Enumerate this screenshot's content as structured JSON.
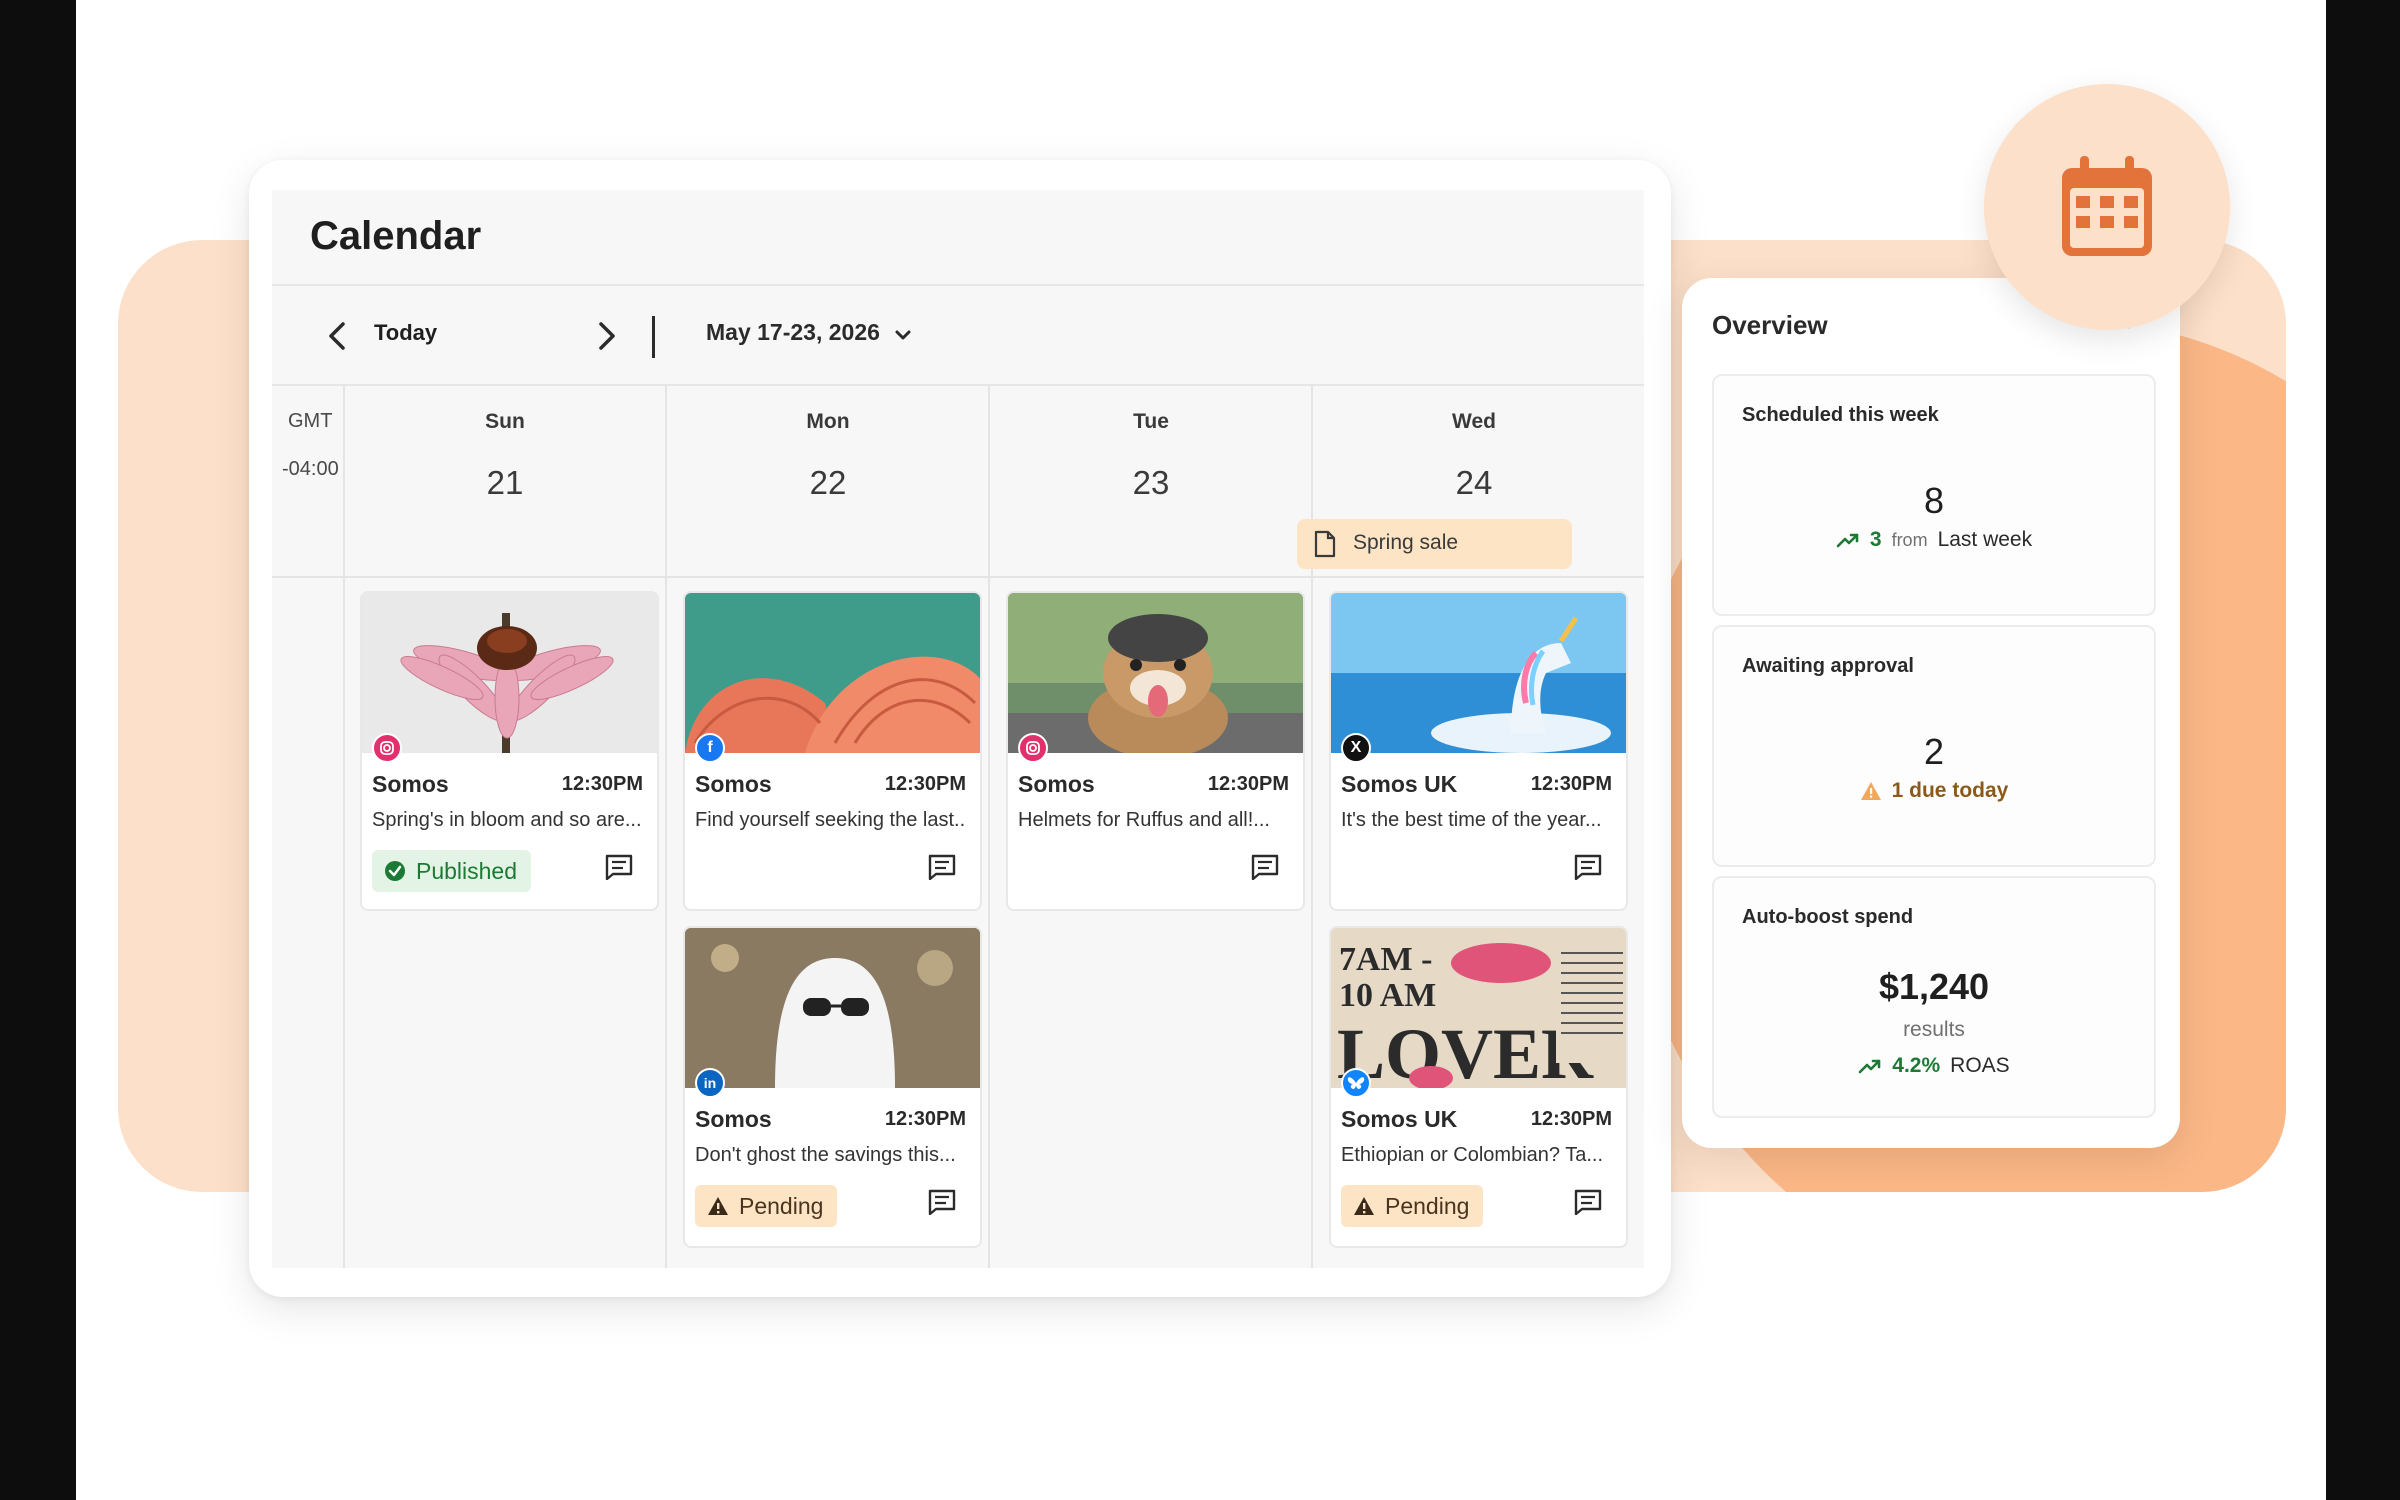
{
  "calendar": {
    "title": "Calendar",
    "toolbar": {
      "today_label": "Today",
      "range_label": "May 17-23, 2026"
    },
    "timezone": {
      "label": "GMT",
      "offset": "-04:00"
    },
    "days": [
      {
        "name": "Sun",
        "number": "21"
      },
      {
        "name": "Mon",
        "number": "22"
      },
      {
        "name": "Tue",
        "number": "23"
      },
      {
        "name": "Wed",
        "number": "24"
      }
    ],
    "event": {
      "label": "Spring sale"
    },
    "posts": [
      {
        "account": "Somos",
        "time": "12:30PM",
        "caption": "Spring's in bloom and so are...",
        "network": "instagram-icon",
        "status": "Published"
      },
      {
        "account": "Somos",
        "time": "12:30PM",
        "caption": "Find yourself seeking the last..",
        "network": "facebook-icon"
      },
      {
        "account": "Somos",
        "time": "12:30PM",
        "caption": "Helmets for Ruffus and all!...",
        "network": "instagram-icon"
      },
      {
        "account": "Somos UK",
        "time": "12:30PM",
        "caption": "It's the best time of the year...",
        "network": "x-icon"
      },
      {
        "account": "Somos",
        "time": "12:30PM",
        "caption": "Don't ghost the savings this...",
        "network": "linkedin-icon",
        "status": "Pending"
      },
      {
        "account": "Somos UK",
        "time": "12:30PM",
        "caption": "Ethiopian or Colombian? Ta...",
        "network": "bluesky-icon",
        "status": "Pending"
      }
    ],
    "thumb5_text": {
      "line1": "7AM -",
      "line2": "10 AM",
      "line3": "LOVER"
    }
  },
  "overview": {
    "title": "Overview",
    "scheduled": {
      "label": "Scheduled this week",
      "value": "8",
      "delta": "3",
      "from": "from",
      "compare": "Last week"
    },
    "approval": {
      "label": "Awaiting approval",
      "value": "2",
      "note": "1 due today"
    },
    "boost": {
      "label": "Auto-boost spend",
      "value": "$1,240",
      "results": "results",
      "roas_value": "4.2%",
      "roas_label": "ROAS"
    }
  },
  "colors": {
    "accent": "#e2733a",
    "peach": "#fde0c9",
    "published_green": "#1b7a33",
    "pending_bg": "#fde4c4",
    "instagram": "#e1306c",
    "facebook": "#1877f2",
    "linkedin": "#0a66c2",
    "bluesky": "#1185fe"
  }
}
